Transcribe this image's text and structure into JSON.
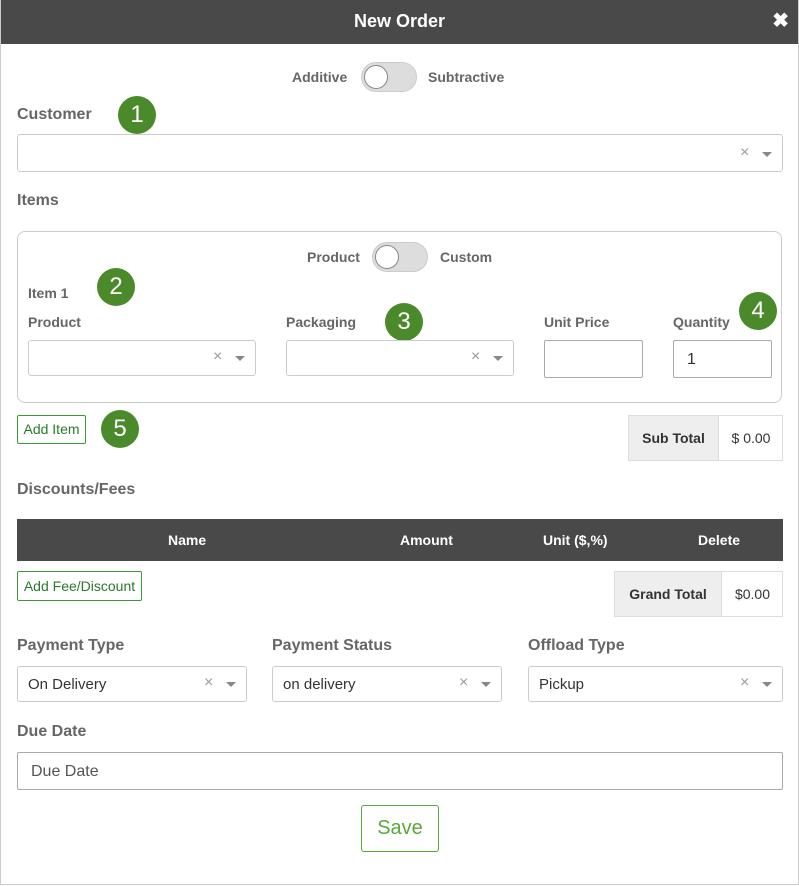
{
  "modal": {
    "title": "New Order",
    "close_icon": "close-icon"
  },
  "mode_toggle": {
    "left_label": "Additive",
    "right_label": "Subtractive"
  },
  "customer": {
    "label": "Customer",
    "value": ""
  },
  "items": {
    "section_label": "Items",
    "type_toggle": {
      "left_label": "Product",
      "right_label": "Custom"
    },
    "item_title": "Item 1",
    "product_label": "Product",
    "packaging_label": "Packaging",
    "unit_price_label": "Unit Price",
    "unit_price_value": "",
    "quantity_label": "Quantity",
    "quantity_value": "1"
  },
  "add_item_label": "Add Item",
  "subtotal": {
    "label": "Sub Total",
    "value": "$ 0.00"
  },
  "discounts": {
    "section_label": "Discounts/Fees",
    "columns": [
      "Name",
      "Amount",
      "Unit ($,%)",
      "Delete"
    ],
    "add_label": "Add Fee/Discount"
  },
  "grand_total": {
    "label": "Grand Total",
    "value": "$0.00"
  },
  "payment_type": {
    "label": "Payment Type",
    "value": "On Delivery"
  },
  "payment_status": {
    "label": "Payment Status",
    "value": "on delivery"
  },
  "offload_type": {
    "label": "Offload Type",
    "value": "Pickup"
  },
  "due_date": {
    "label": "Due Date",
    "placeholder": "Due Date"
  },
  "save_label": "Save",
  "badges": [
    "1",
    "2",
    "3",
    "4",
    "5"
  ],
  "colors": {
    "header": "#494949",
    "badge": "#4a8a2a",
    "save": "#5aa83a"
  }
}
